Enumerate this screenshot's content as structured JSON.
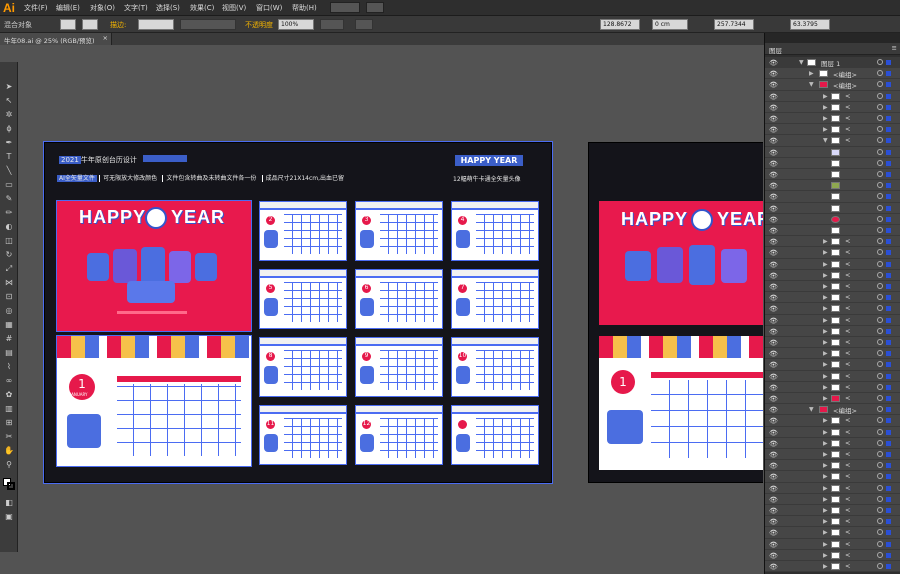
{
  "app": {
    "logo": "Ai"
  },
  "menubar": {
    "items": [
      "文件(F)",
      "编辑(E)",
      "对象(O)",
      "文字(T)",
      "选择(S)",
      "效果(C)",
      "视图(V)",
      "窗口(W)",
      "帮助(H)"
    ]
  },
  "control_bar": {
    "selection_label": "混合对象",
    "stroke_label": "描边:",
    "opacity_label": "不透明度",
    "opacity_value": "100%",
    "x_value": "128.8672",
    "y_value": "0 cm",
    "w_value": "257.7344",
    "h_value": "63.3795"
  },
  "document_tab": {
    "title": "牛年08.ai @ 25% (RGB/预览)"
  },
  "artboard": {
    "title_year": "2021",
    "title_text": "牛年原创台历设计",
    "features": [
      "AI全矢量文件",
      "可无限放大修改颜色",
      "文件包含转曲及未转曲文件各一份",
      "成品尺寸21X14cm,出血已留"
    ],
    "right_title": "HAPPY YEAR",
    "right_sub": "12幅萌牛卡通全矢量头像",
    "happy_left": "HAPPY",
    "happy_right": "YEAR",
    "month_label": "JANUARY",
    "month_numbers": [
      "2",
      "3",
      "4",
      "5",
      "6",
      "7",
      "8",
      "9",
      "10",
      "11",
      "12"
    ],
    "big_month": "1"
  },
  "layers_panel": {
    "tab": "图层",
    "top_layer": "图层 1",
    "group_label": "<编组>",
    "path_label": "<"
  }
}
